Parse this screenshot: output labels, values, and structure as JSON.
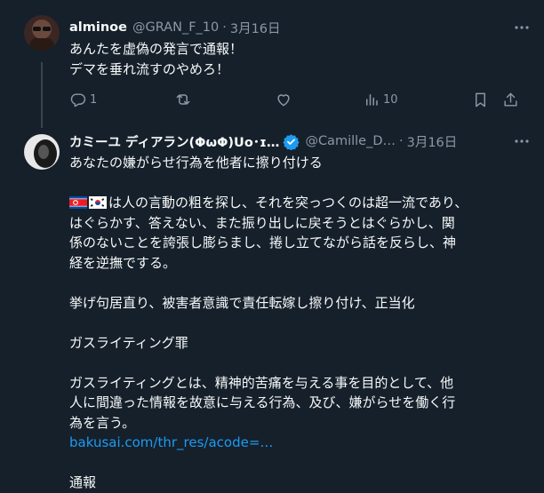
{
  "post1": {
    "name": "alminoe",
    "handle": "@GRAN_F_10",
    "separator": "·",
    "time": "3月16日",
    "lines": [
      "あんたを虚偽の発言で通報！",
      "デマを垂れ流すのやめろ！"
    ],
    "reply_count": "1",
    "view_count": "10"
  },
  "post2": {
    "name": "カミーユ ディアラン(ΦωΦ)Uo･ɪ…",
    "handle": "@Camille_D…",
    "separator": "·",
    "time": "3月16日",
    "line1": "あなたの嫌がらせ行為を他者に擦り付ける",
    "para2_first": "は人の言動の粗を探し、それを突っつくのは超一流であり、",
    "para2_lines": [
      "はぐらかす、答えない、また振り出しに戻そうとはぐらかし、関",
      "係のないことを誇張し膨らまし、捲し立てながら話を反らし、神",
      "経を逆撫でする。"
    ],
    "para3": "挙げ句居直り、被害者意識で責任転嫁し擦り付け、正当化",
    "para4": "ガスライティング罪",
    "para5_lines": [
      "ガスライティングとは、精神的苦痛を与える事を目的として、他",
      "人に間違った情報を故意に与える行為、及び、嫌がらせを働く行",
      "為を言う。"
    ],
    "link": "bakusai.com/thr_res/acode=…",
    "last": "通報"
  },
  "colors": {
    "background": "#15202b",
    "text": "#f7f9f9",
    "secondary": "#8b98a5",
    "link": "#1d9bf0",
    "verified": "#1d9bf0",
    "thread_line": "#38444d"
  },
  "icons": [
    "more-icon",
    "reply-icon",
    "retweet-icon",
    "like-icon",
    "views-icon",
    "bookmark-icon",
    "share-icon",
    "verified-badge-icon",
    "north-korea-flag-icon",
    "south-korea-flag-icon"
  ]
}
